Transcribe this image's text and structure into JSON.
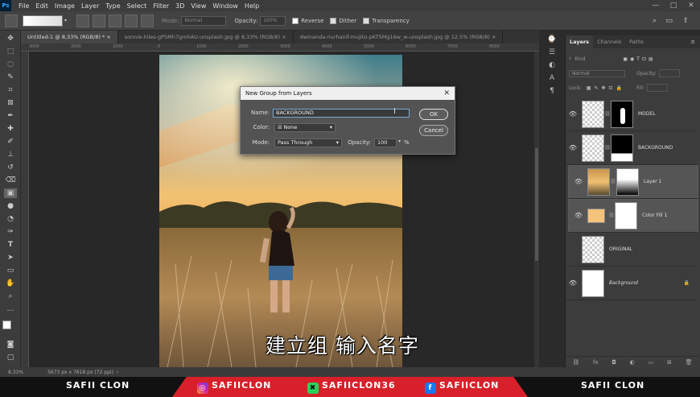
{
  "app": {
    "logo": "Ps"
  },
  "menu": [
    "File",
    "Edit",
    "Image",
    "Layer",
    "Type",
    "Select",
    "Filter",
    "3D",
    "View",
    "Window",
    "Help"
  ],
  "window_controls": [
    "—",
    "□",
    "✕"
  ],
  "options": {
    "mode_label": "Mode:",
    "mode_value": "Normal",
    "opacity_label": "Opacity:",
    "opacity_value": "100%",
    "reverse": "Reverse",
    "dither": "Dither",
    "transparency": "Transparency"
  },
  "tabs": [
    "Untitled-1 @ 8,33% (RGB/8) *",
    "sonnie-hiles-gPSMh7gmhAU-unsplash.jpg @ 8,33% (RGB/8)",
    "dwinanda-nurhanif-mujito-pKT5Mg16w_w-unsplash.jpg @ 12,5% (RGB/8)"
  ],
  "ruler": [
    "3000",
    "2000",
    "1000",
    "0",
    "1000",
    "2000",
    "3000",
    "4000",
    "5000",
    "6000",
    "7000",
    "8000"
  ],
  "status": {
    "zoom": "8,33%",
    "dimensions": "5673 px x 7618 px (72 ppi)"
  },
  "panel": {
    "tabs": [
      "Layers",
      "Channels",
      "Paths"
    ],
    "kind_label": "Kind",
    "blend": "Normal",
    "opacity_label": "Opacity:",
    "opacity_value": "",
    "lock_label": "Lock:",
    "fill_label": "Fill:",
    "layers": [
      {
        "name": "MODEL"
      },
      {
        "name": "BACKGROUND"
      },
      {
        "name": "Layer 1"
      },
      {
        "name": "Color Fill 1"
      },
      {
        "name": "ORIGINAL"
      },
      {
        "name": "Background"
      }
    ]
  },
  "dialog": {
    "title": "New Group from Layers",
    "name_label": "Name:",
    "name_value": "BACKGROUND",
    "color_label": "Color:",
    "color_value": "None",
    "mode_label": "Mode:",
    "mode_value": "Pass Through",
    "opacity_label": "Opacity:",
    "opacity_value": "100",
    "opacity_unit": "%",
    "ok": "OK",
    "cancel": "Cancel"
  },
  "subtitle": "建立组  输入名字",
  "banner": {
    "left": "SAFII CLON",
    "instagram": "SAFIICLON",
    "other": "SAFIICLON36",
    "facebook": "SAFIICLON",
    "right": "SAFII CLON"
  },
  "colors": {
    "accent": "#d8202a",
    "ps_blue": "#31a8ff",
    "color_fill": "#f5c27a"
  }
}
